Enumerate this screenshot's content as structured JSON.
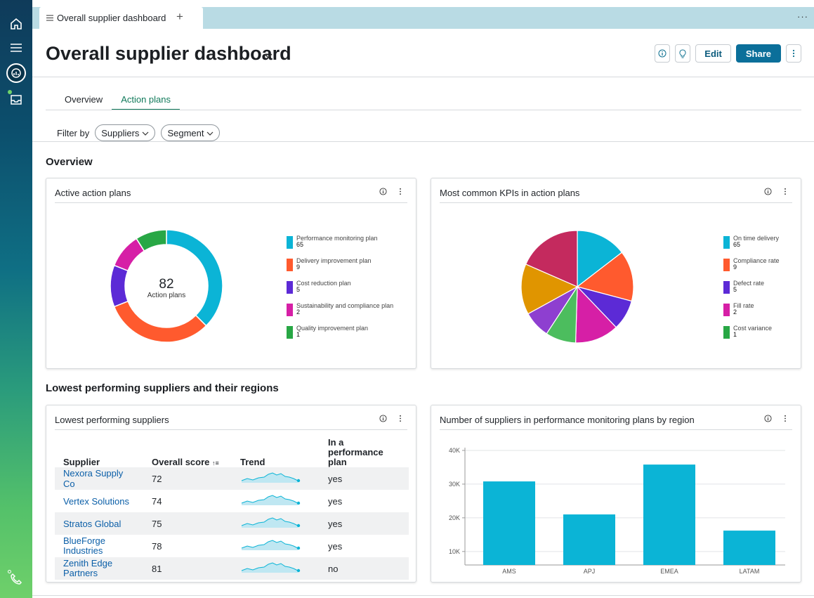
{
  "tab": {
    "icon": "list-icon",
    "label": "Overall supplier dashboard"
  },
  "header": {
    "title": "Overall supplier dashboard",
    "edit_label": "Edit",
    "share_label": "Share"
  },
  "tabs": [
    {
      "label": "Overview",
      "active": false
    },
    {
      "label": "Action plans",
      "active": true
    }
  ],
  "filter": {
    "label": "Filter by",
    "chips": [
      "Suppliers",
      "Segment"
    ]
  },
  "sections": {
    "overview": "Overview",
    "lowest": "Lowest performing suppliers and their regions"
  },
  "colors": {
    "cyan": "#0bb4d6",
    "orange": "#ff5a2e",
    "purple": "#5c2ad6",
    "magenta": "#d61fa6",
    "green": "#28a745",
    "darkred": "#c42a5e",
    "amber": "#e09500",
    "violet": "#8e3fd0",
    "lightgreen": "#4cbd5e"
  },
  "cards": {
    "active_plans": {
      "title": "Active action plans",
      "center_value": "82",
      "center_label": "Action plans",
      "legend": [
        {
          "name": "Performance monitoring plan",
          "value": "65",
          "color": "#0bb4d6"
        },
        {
          "name": "Delivery improvement plan",
          "value": "9",
          "color": "#ff5a2e"
        },
        {
          "name": "Cost reduction plan",
          "value": "5",
          "color": "#5c2ad6"
        },
        {
          "name": "Sustainability and compliance plan",
          "value": "2",
          "color": "#d61fa6"
        },
        {
          "name": "Quality improvement plan",
          "value": "1",
          "color": "#28a745"
        }
      ]
    },
    "kpis": {
      "title": "Most common KPIs in action plans",
      "legend": [
        {
          "name": "On time delivery",
          "value": "65",
          "color": "#0bb4d6"
        },
        {
          "name": "Compliance rate",
          "value": "9",
          "color": "#ff5a2e"
        },
        {
          "name": "Defect rate",
          "value": "5",
          "color": "#5c2ad6"
        },
        {
          "name": "Fill rate",
          "value": "2",
          "color": "#d61fa6"
        },
        {
          "name": "Cost variance",
          "value": "1",
          "color": "#28a745"
        }
      ]
    },
    "suppliers": {
      "title": "Lowest performing suppliers",
      "columns": [
        "Supplier",
        "Overall score",
        "Trend",
        "In a performance plan"
      ],
      "rows": [
        {
          "name": "Nexora Supply Co",
          "score": "72",
          "plan": "yes"
        },
        {
          "name": "Vertex Solutions",
          "score": "74",
          "plan": "yes"
        },
        {
          "name": "Stratos Global",
          "score": "75",
          "plan": "yes"
        },
        {
          "name": "BlueForge Industries",
          "score": "78",
          "plan": "yes"
        },
        {
          "name": "Zenith Edge Partners",
          "score": "81",
          "plan": "no"
        }
      ]
    },
    "regions": {
      "title": "Number of suppliers in performance monitoring plans by region"
    }
  },
  "chart_data": [
    {
      "type": "pie",
      "title": "Active action plans",
      "categories": [
        "Performance monitoring plan",
        "Delivery improvement plan",
        "Cost reduction plan",
        "Sustainability and compliance plan",
        "Quality improvement plan"
      ],
      "values": [
        65,
        9,
        5,
        2,
        1
      ],
      "donut": true,
      "legend": "right"
    },
    {
      "type": "pie",
      "title": "Most common KPIs in action plans",
      "values": [
        15,
        15,
        9,
        13,
        9,
        8,
        15,
        19
      ],
      "legend": "right"
    },
    {
      "type": "bar",
      "title": "Number of suppliers in performance monitoring plans by region",
      "categories": [
        "AMS",
        "APJ",
        "EMEA",
        "LATAM"
      ],
      "values": [
        30800,
        21000,
        35800,
        16200
      ],
      "ylim": [
        6000,
        45000
      ],
      "yticks": [
        "10K",
        "20K",
        "30K",
        "40K"
      ],
      "grid": true
    }
  ]
}
